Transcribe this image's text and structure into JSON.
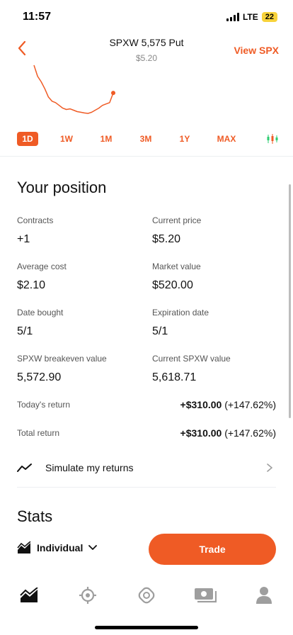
{
  "status": {
    "time": "11:57",
    "network": "LTE",
    "battery": "22"
  },
  "header": {
    "title": "SPXW 5,575 Put",
    "price": "$5.20",
    "view_link": "View SPX"
  },
  "colors": {
    "accent": "#ef5b25",
    "text": "#111111",
    "muted": "#555555"
  },
  "chart_data": {
    "type": "line",
    "series": [
      {
        "values": [
          7.2,
          6.4,
          6.0,
          5.5,
          4.9,
          4.6,
          4.5,
          4.3,
          4.1,
          4.0,
          4.05,
          3.95,
          3.85,
          3.8,
          3.75,
          3.72,
          3.8,
          3.95,
          4.1,
          4.3,
          4.4,
          4.5,
          5.2
        ]
      }
    ],
    "end_marker": true
  },
  "ranges": [
    {
      "label": "1D",
      "active": true
    },
    {
      "label": "1W"
    },
    {
      "label": "1M"
    },
    {
      "label": "3M"
    },
    {
      "label": "1Y"
    },
    {
      "label": "MAX"
    }
  ],
  "position": {
    "title": "Your position",
    "contracts_label": "Contracts",
    "contracts_value": "+1",
    "current_price_label": "Current price",
    "current_price_value": "$5.20",
    "avg_cost_label": "Average cost",
    "avg_cost_value": "$2.10",
    "market_value_label": "Market value",
    "market_value_value": "$520.00",
    "date_bought_label": "Date bought",
    "date_bought_value": "5/1",
    "expiration_label": "Expiration date",
    "expiration_value": "5/1",
    "breakeven_label": "SPXW breakeven value",
    "breakeven_value": "5,572.90",
    "current_spxw_label": "Current SPXW value",
    "current_spxw_value": "5,618.71",
    "todays_return_label": "Today's return",
    "todays_return_amount": "+$310.00",
    "todays_return_pct": "(+147.62%)",
    "total_return_label": "Total return",
    "total_return_amount": "+$310.00",
    "total_return_pct": "(+147.62%)",
    "simulate_label": "Simulate my returns"
  },
  "stats": {
    "title": "Stats"
  },
  "footer": {
    "account_label": "Individual",
    "trade_label": "Trade"
  },
  "tabbar": [
    "investing-icon",
    "crypto-icon",
    "options-network-icon",
    "cash-icon",
    "account-icon"
  ]
}
